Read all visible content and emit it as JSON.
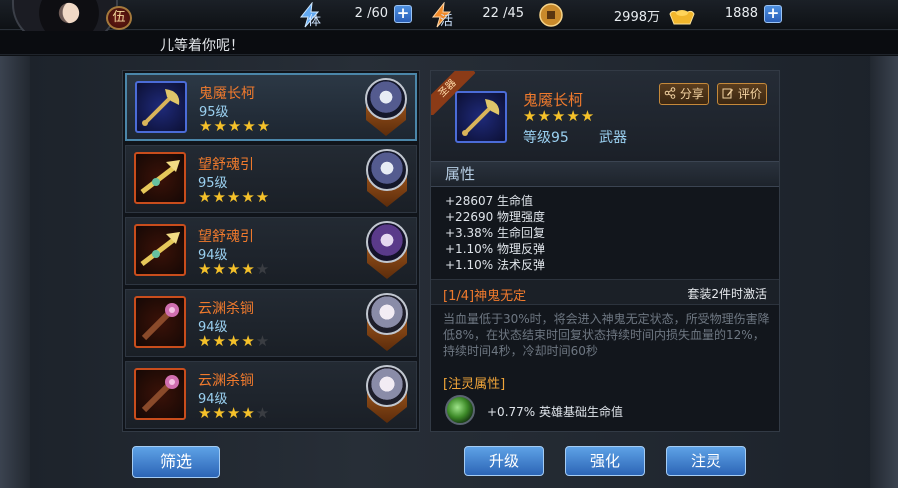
{
  "player": {
    "level_badge": "伍"
  },
  "stats": {
    "stamina": {
      "label": "体",
      "value": "2 /60"
    },
    "vitality": {
      "label": "活",
      "value": "22 /45"
    },
    "coins": {
      "value": "2998万"
    },
    "gold": {
      "value": "1888"
    },
    "plus": "+"
  },
  "marquee": "儿等着你呢！",
  "items": [
    {
      "name": "鬼魇长柯",
      "level": "95级",
      "stars": 5,
      "selected": true
    },
    {
      "name": "望舒魂引",
      "level": "95级",
      "stars": 5,
      "selected": false
    },
    {
      "name": "望舒魂引",
      "level": "94级",
      "stars": 4,
      "selected": false
    },
    {
      "name": "云渊杀锏",
      "level": "94级",
      "stars": 4,
      "selected": false
    },
    {
      "name": "云渊杀锏",
      "level": "94级",
      "stars": 4,
      "selected": false
    }
  ],
  "filter_button": "筛选",
  "detail": {
    "ribbon": "圣器",
    "name": "鬼魇长柯",
    "stars": 5,
    "level": "等级95",
    "type": "武器",
    "share": "分享",
    "review": "评价",
    "attributes_title": "属性",
    "attributes": [
      "+28607 生命值",
      "+22690 物理强度",
      "+3.38% 生命回复",
      "+1.10% 物理反弹",
      "+1.10% 法术反弹"
    ],
    "set_name": "[1/4]神鬼无定",
    "set_active": "套装2件时激活",
    "set_desc": "当血量低于30%时，将会进入神鬼无定状态，所受物理伤害降低8%，在状态结束时回复状态持续时间内损失血量的12%，持续时间4秒，冷却时间60秒",
    "spirit_title": "[注灵属性]",
    "spirit_value": "+0.77% 英雄基础生命值"
  },
  "actions": {
    "upgrade": "升级",
    "enhance": "强化",
    "infuse": "注灵"
  },
  "colors": {
    "accent_orange": "#f07a2d",
    "level_blue": "#9ad0f0",
    "star_gold": "#f5c12a",
    "button_blue": "#3a7fd0"
  }
}
